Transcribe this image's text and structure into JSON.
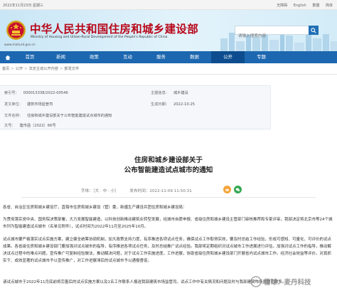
{
  "topbar": {
    "date": "2022年11月23日 星期三",
    "links": [
      "无障碍",
      "English",
      "繁體",
      "简体"
    ]
  },
  "header": {
    "title": "中华人民共和国住房和城乡建设部",
    "subtitle": "Ministry of Housing and Urban-Rural Development of the People's Republic of China",
    "url": "www.mohurd.gov.cn",
    "search_placeholder": "请输入搜索内容"
  },
  "nav": {
    "items": [
      "首页",
      "新闻",
      "政策",
      "互动",
      "服务",
      "数据",
      "公开",
      "专题"
    ],
    "active": "公开"
  },
  "breadcrumb": [
    "首页",
    "公开",
    "法定主动公开内容",
    "部发文件"
  ],
  "info": {
    "rows": [
      {
        "label": "索引号：",
        "value": "000013338/2022-00546"
      },
      {
        "label": "主题信息：",
        "value": "城乡建设"
      },
      {
        "label": "发文单位：",
        "value": "建筑市场监管司"
      },
      {
        "label": "生成日期：",
        "value": "2022-10-25"
      },
      {
        "label": "文件名称：",
        "value": "住房和城乡建设部关于公布智能建造试点城市的通知"
      },
      {
        "label": "文号：",
        "value": "建市函〔2022〕66号"
      }
    ]
  },
  "article": {
    "title_line1": "住房和城乡建设部关于",
    "title_line2": "公布智能建造试点城市的通知",
    "font_label": "字体：",
    "font_options": "［大 · 中 · 小］",
    "publish_time": "发布时间：2022-11-09 11:50:31",
    "paragraphs": [
      "各省、自治区住房和城乡建设厅，直辖市住房和城乡建设（管）委，新疆生产建设兵团住房和城乡建设局：",
      "为贯彻落实党中央、国务院决策部署，大力发展智能建造，以科技创新推动建筑业转型发展，经城市自愿申报、省级住房和城乡建设主管部门审核推荐和专家评审，我部决定将北京市等24个城市列为智能建造试点城市（名单见附件），试点时间为2022年11月至2025年10月。",
      "试点城市要严格落实试点实施方案，建立健全统筹协调机制，加大政策支持力度，有序推进各项试点任务，确保试点工作取得实效，要及时总结工作经验，形成可感知、可量化、可评价的试点成果。各省级住房和城乡建设部门要加强对试点城市的指导，有序推进各项试点任务，及时总结推广试点经验。我部将定期组织对试点城市工作进展进行评估，加强对试点工作的指导，推动解决试点过程中的难点问题，宣传推广可复制经验做法，推动解决问题，对于试点工作实施进度，工作进展，协助省级住房和城乡建设部门开展省内试点城市工作。经济社会效益等评价。对真抓实干、成效显著的试点城市予以宣传推广，对工作进展滞后的试点城市予以通报督促。",
      "请试点城市于2022年11月底前将完善后的试点实施方案以及1名工作联系人报送我部建筑市场监管司。试点工作中有关情况和问题及时与我部建筑市场监管司联系。"
    ]
  },
  "watermark": {
    "text": "雪球：麦丹科技"
  },
  "colors": {
    "brand_red": "#b8081a",
    "nav_blue": "#1c67b0",
    "nav_active": "#0d4d8f"
  }
}
